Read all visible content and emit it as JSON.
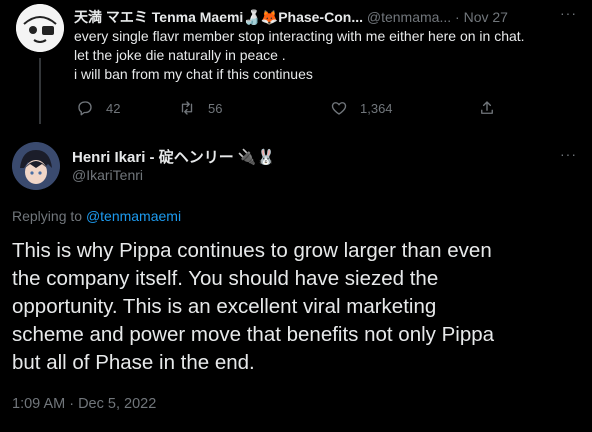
{
  "parent_tweet": {
    "display_name": "天満 マエミ Tenma Maemi🍶🦊Phase-Con...",
    "handle": "@tenmama...",
    "separator": "·",
    "date": "Nov 27",
    "lines": [
      "every single flavr member stop interacting with me either here on in chat.",
      "let the joke die naturally in peace .",
      "i will ban from my chat if this continues"
    ],
    "reply_count": "42",
    "retweet_count": "56",
    "like_count": "1,364"
  },
  "reply_tweet": {
    "display_name": "Henri Ikari - 碇ヘンリー 🔌🐰",
    "handle": "@IkariTenri",
    "replying_to_label": "Replying to",
    "replying_to_handle": "@tenmamaemi",
    "lines": [
      "This is why Pippa continues to grow larger than even",
      "the company itself. You should have siezed the",
      "opportunity. This is an excellent viral marketing",
      "scheme and power move that benefits not only Pippa",
      "but all of Phase in the end."
    ],
    "timestamp": "1:09 AM · Dec 5, 2022"
  },
  "colors": {
    "background": "#000000",
    "text": "#e7e9ea",
    "muted": "#71767b",
    "link": "#1d9bf0"
  },
  "icons": [
    "reply-icon",
    "retweet-icon",
    "like-icon",
    "share-icon",
    "more-icon"
  ]
}
